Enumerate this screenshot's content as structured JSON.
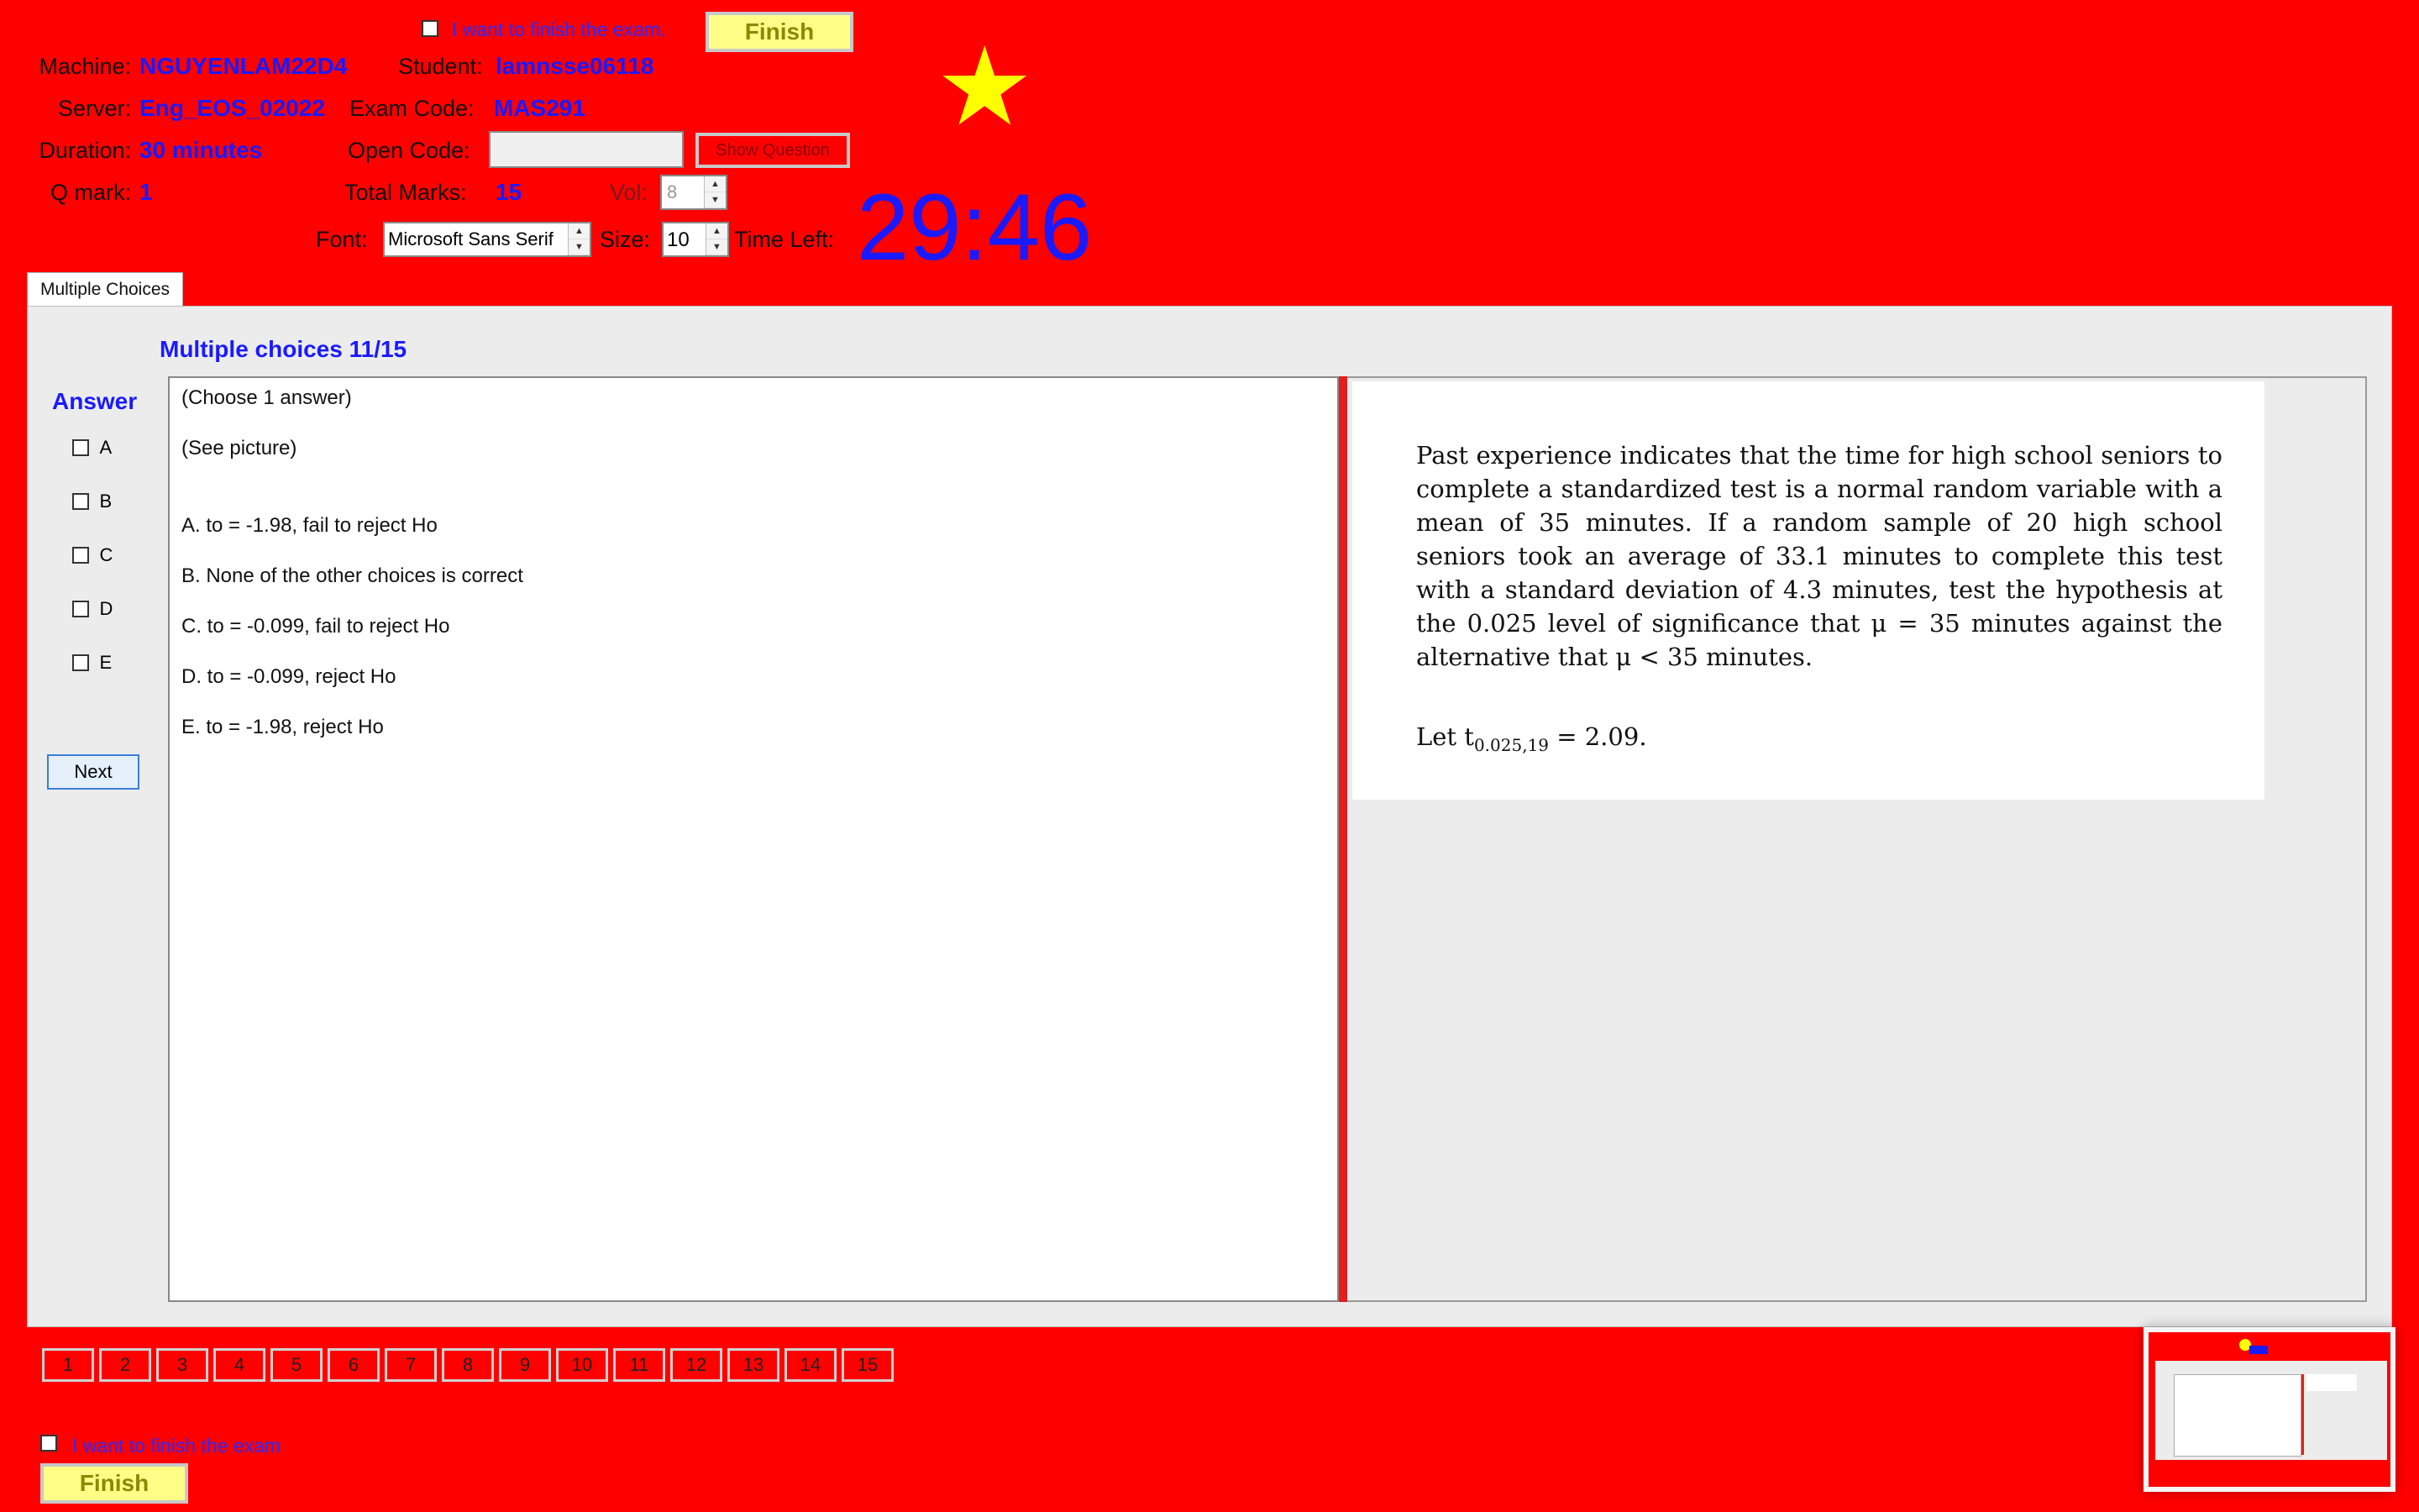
{
  "top_finish": {
    "checkbox_label": "I want to finish the exam.",
    "button_label": "Finish"
  },
  "info": {
    "machine_label": "Machine:",
    "machine_value": "NGUYENLAM22D4",
    "student_label": "Student:",
    "student_value": "lamnsse06118",
    "server_label": "Server:",
    "server_value": "Eng_EOS_02022",
    "exam_code_label": "Exam Code:",
    "exam_code_value": "MAS291",
    "duration_label": "Duration:",
    "duration_value": "30 minutes",
    "open_code_label": "Open Code:",
    "open_code_value": "",
    "show_question_label": "Show Question",
    "q_mark_label": "Q mark:",
    "q_mark_value": "1",
    "total_marks_label": "Total Marks:",
    "total_marks_value": "15",
    "vol_label": "Vol:",
    "vol_value": "8",
    "font_label": "Font:",
    "font_value": "Microsoft Sans Serif",
    "size_label": "Size:",
    "size_value": "10",
    "time_left_label": "Time Left:",
    "time_left_value": "29:46"
  },
  "star_glyph": "★",
  "tab": {
    "label": "Multiple Choices"
  },
  "question": {
    "header": "Multiple choices 11/15",
    "answer_label": "Answer",
    "options": [
      "A",
      "B",
      "C",
      "D",
      "E"
    ],
    "next_label": "Next",
    "lines": {
      "instruction": "(Choose 1 answer)",
      "see_picture": "(See picture)",
      "a": "A.  to = -1.98, fail to reject Ho",
      "b": "B.  None of the other choices is correct",
      "c": "C.  to = -0.099, fail to reject Ho",
      "d": "D.  to = -0.099, reject Ho",
      "e": "E.  to = -1.98, reject Ho"
    },
    "picture": {
      "paragraph": "Past experience indicates that the time for high school seniors to complete a standardized test is a normal random variable with a mean of 35 minutes. If a random sample of 20 high school seniors took an average of 33.1 minutes to complete this test with a standard deviation of 4.3 minutes, test the hypothesis at the 0.025 level of significance that μ = 35 minutes against the alternative that μ < 35 minutes.",
      "let_prefix": "Let t",
      "let_sub": "0.025,19",
      "let_suffix": " = 2.09."
    }
  },
  "nav": [
    "1",
    "2",
    "3",
    "4",
    "5",
    "6",
    "7",
    "8",
    "9",
    "10",
    "11",
    "12",
    "13",
    "14",
    "15"
  ],
  "bottom_finish": {
    "checkbox_label": "I want to finish the exam",
    "button_label": "Finish"
  },
  "colors": {
    "background": "#ff0000",
    "accent_blue": "#1a1aff",
    "finish_yellow": "#ffff88"
  }
}
